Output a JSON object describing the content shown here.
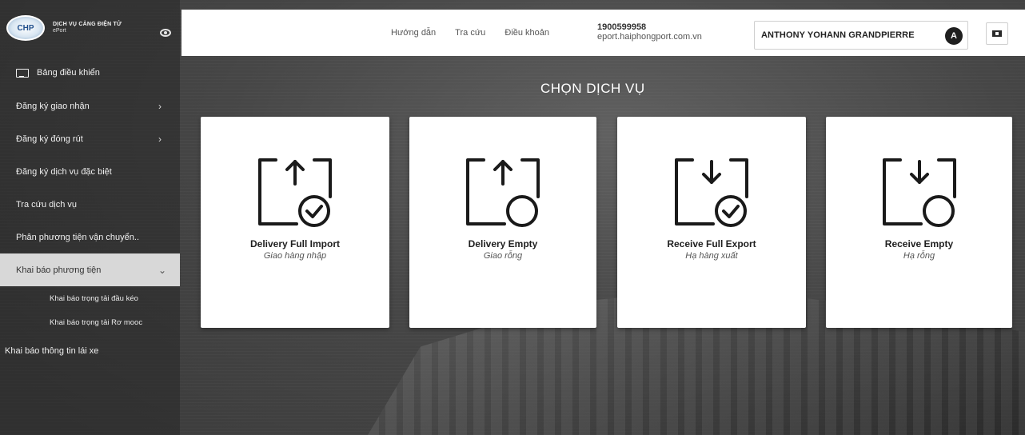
{
  "brand": {
    "logo_text": "CHP",
    "title": "DỊCH VỤ CẢNG ĐIỆN TỬ",
    "subtitle": "ePort"
  },
  "sidebar": {
    "items": [
      {
        "label": "Bảng điều khiển"
      },
      {
        "label": "Đăng ký giao nhận"
      },
      {
        "label": "Đăng ký đóng rút"
      },
      {
        "label": "Đăng ký dịch vụ đặc biệt"
      },
      {
        "label": "Tra cứu dịch vụ"
      },
      {
        "label": "Phân phương tiện vận chuyển.."
      },
      {
        "label": "Khai báo phương tiện"
      },
      {
        "label": "Khai báo trọng tải đầu kéo"
      },
      {
        "label": "Khai báo trọng tải Rơ mooc"
      },
      {
        "label": "Khai báo thông tin lái xe"
      }
    ],
    "chevron_right": "›",
    "chevron_down": "⌄"
  },
  "topbar": {
    "links": [
      "Hướng dẫn",
      "Tra cứu",
      "Điều khoản"
    ],
    "phone": "1900599958",
    "website": "eport.haiphongport.com.vn",
    "user_name": "ANTHONY YOHANN GRANDPIERRE",
    "user_initial": "A"
  },
  "main": {
    "title": "CHỌN DỊCH VỤ",
    "cards": [
      {
        "title": "Delivery Full Import",
        "subtitle": "Giao hàng nhập",
        "icon": "box-arrow-up-check-icon"
      },
      {
        "title": "Delivery Empty",
        "subtitle": "Giao rỗng",
        "icon": "box-arrow-up-circle-icon"
      },
      {
        "title": "Receive Full Export",
        "subtitle": "Hạ hàng xuất",
        "icon": "box-arrow-down-check-icon"
      },
      {
        "title": "Receive Empty",
        "subtitle": "Hạ rỗng",
        "icon": "box-arrow-down-circle-icon"
      }
    ]
  }
}
